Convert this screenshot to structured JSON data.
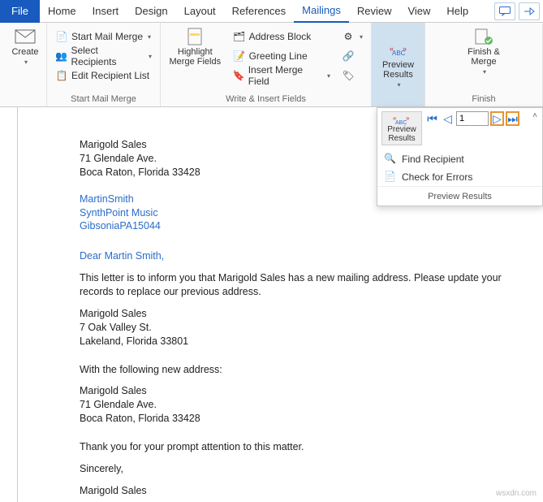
{
  "tabs": {
    "file": "File",
    "home": "Home",
    "insert": "Insert",
    "design": "Design",
    "layout": "Layout",
    "references": "References",
    "mailings": "Mailings",
    "review": "Review",
    "view": "View",
    "help": "Help"
  },
  "ribbon": {
    "create": "Create",
    "start_mail_merge": "Start Mail Merge",
    "select_recipients": "Select Recipients",
    "edit_recipient_list": "Edit Recipient List",
    "group_start": "Start Mail Merge",
    "highlight": "Highlight\nMerge Fields",
    "address_block": "Address Block",
    "greeting_line": "Greeting Line",
    "insert_merge_field": "Insert Merge Field",
    "group_write": "Write & Insert Fields",
    "preview_results": "Preview\nResults",
    "finish_merge": "Finish &\nMerge",
    "group_finish": "Finish"
  },
  "dropdown": {
    "record": "1",
    "find": "Find Recipient",
    "check": "Check for Errors",
    "footer": "Preview Results",
    "mini": "Preview\nResults"
  },
  "doc": {
    "ret_name": "Marigold Sales",
    "ret_addr1": "71 Glendale Ave.",
    "ret_addr2": "Boca Raton, Florida 33428",
    "mf_name": "MartinSmith",
    "mf_company": "SynthPoint Music",
    "mf_addr": "GibsoniaPA15044",
    "greeting": "Dear Martin Smith,",
    "body1": "This letter is to inform you that Marigold Sales has a new mailing address. Please update your records to replace our previous address.",
    "prev_name": "Marigold Sales",
    "prev_addr1": "7 Oak Valley St.",
    "prev_addr2": "Lakeland, Florida 33801",
    "with_new": "With the following new address:",
    "new_name": "Marigold Sales",
    "new_addr1": "71 Glendale Ave.",
    "new_addr2": "Boca Raton, Florida 33428",
    "thanks": "Thank you for your prompt attention to this matter.",
    "sincerely": "Sincerely,",
    "sig": "Marigold Sales"
  },
  "watermark": "wsxdn.com"
}
